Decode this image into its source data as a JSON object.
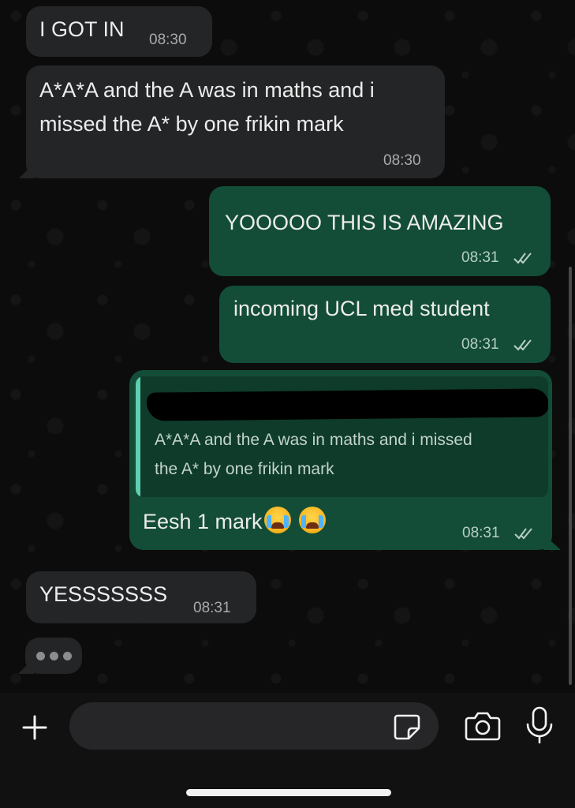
{
  "messages": [
    {
      "direction": "incoming",
      "text": "I GOT IN",
      "time": "08:30"
    },
    {
      "direction": "incoming",
      "lines": [
        "A*A*A and the A was in maths and i",
        "missed the A* by one frikin mark"
      ],
      "time": "08:30"
    },
    {
      "direction": "outgoing",
      "text": "YOOOOO THIS IS AMAZING",
      "time": "08:31",
      "status": "read"
    },
    {
      "direction": "outgoing",
      "text": "incoming UCL med student",
      "time": "08:31",
      "status": "read"
    },
    {
      "direction": "outgoing",
      "reply_to": {
        "lines": [
          "A*A*A and the A was in maths and i missed",
          "the A* by one frikin mark"
        ]
      },
      "text": "Eesh 1 mark",
      "emoji": "loudly-crying-face",
      "emoji_count": 2,
      "time": "08:31",
      "status": "read"
    },
    {
      "direction": "incoming",
      "text": "YESSSSSSS",
      "time": "08:31"
    }
  ],
  "typing_indicator": {
    "dots": 3
  },
  "composer": {
    "placeholder": ""
  },
  "icons": {
    "plus": "plus-icon",
    "sticker": "sticker-icon",
    "camera": "camera-icon",
    "mic": "microphone-icon"
  },
  "colors": {
    "incoming_bubble": "#242527",
    "outgoing_bubble": "#134d37",
    "quote_bar": "#5fcfb0"
  }
}
